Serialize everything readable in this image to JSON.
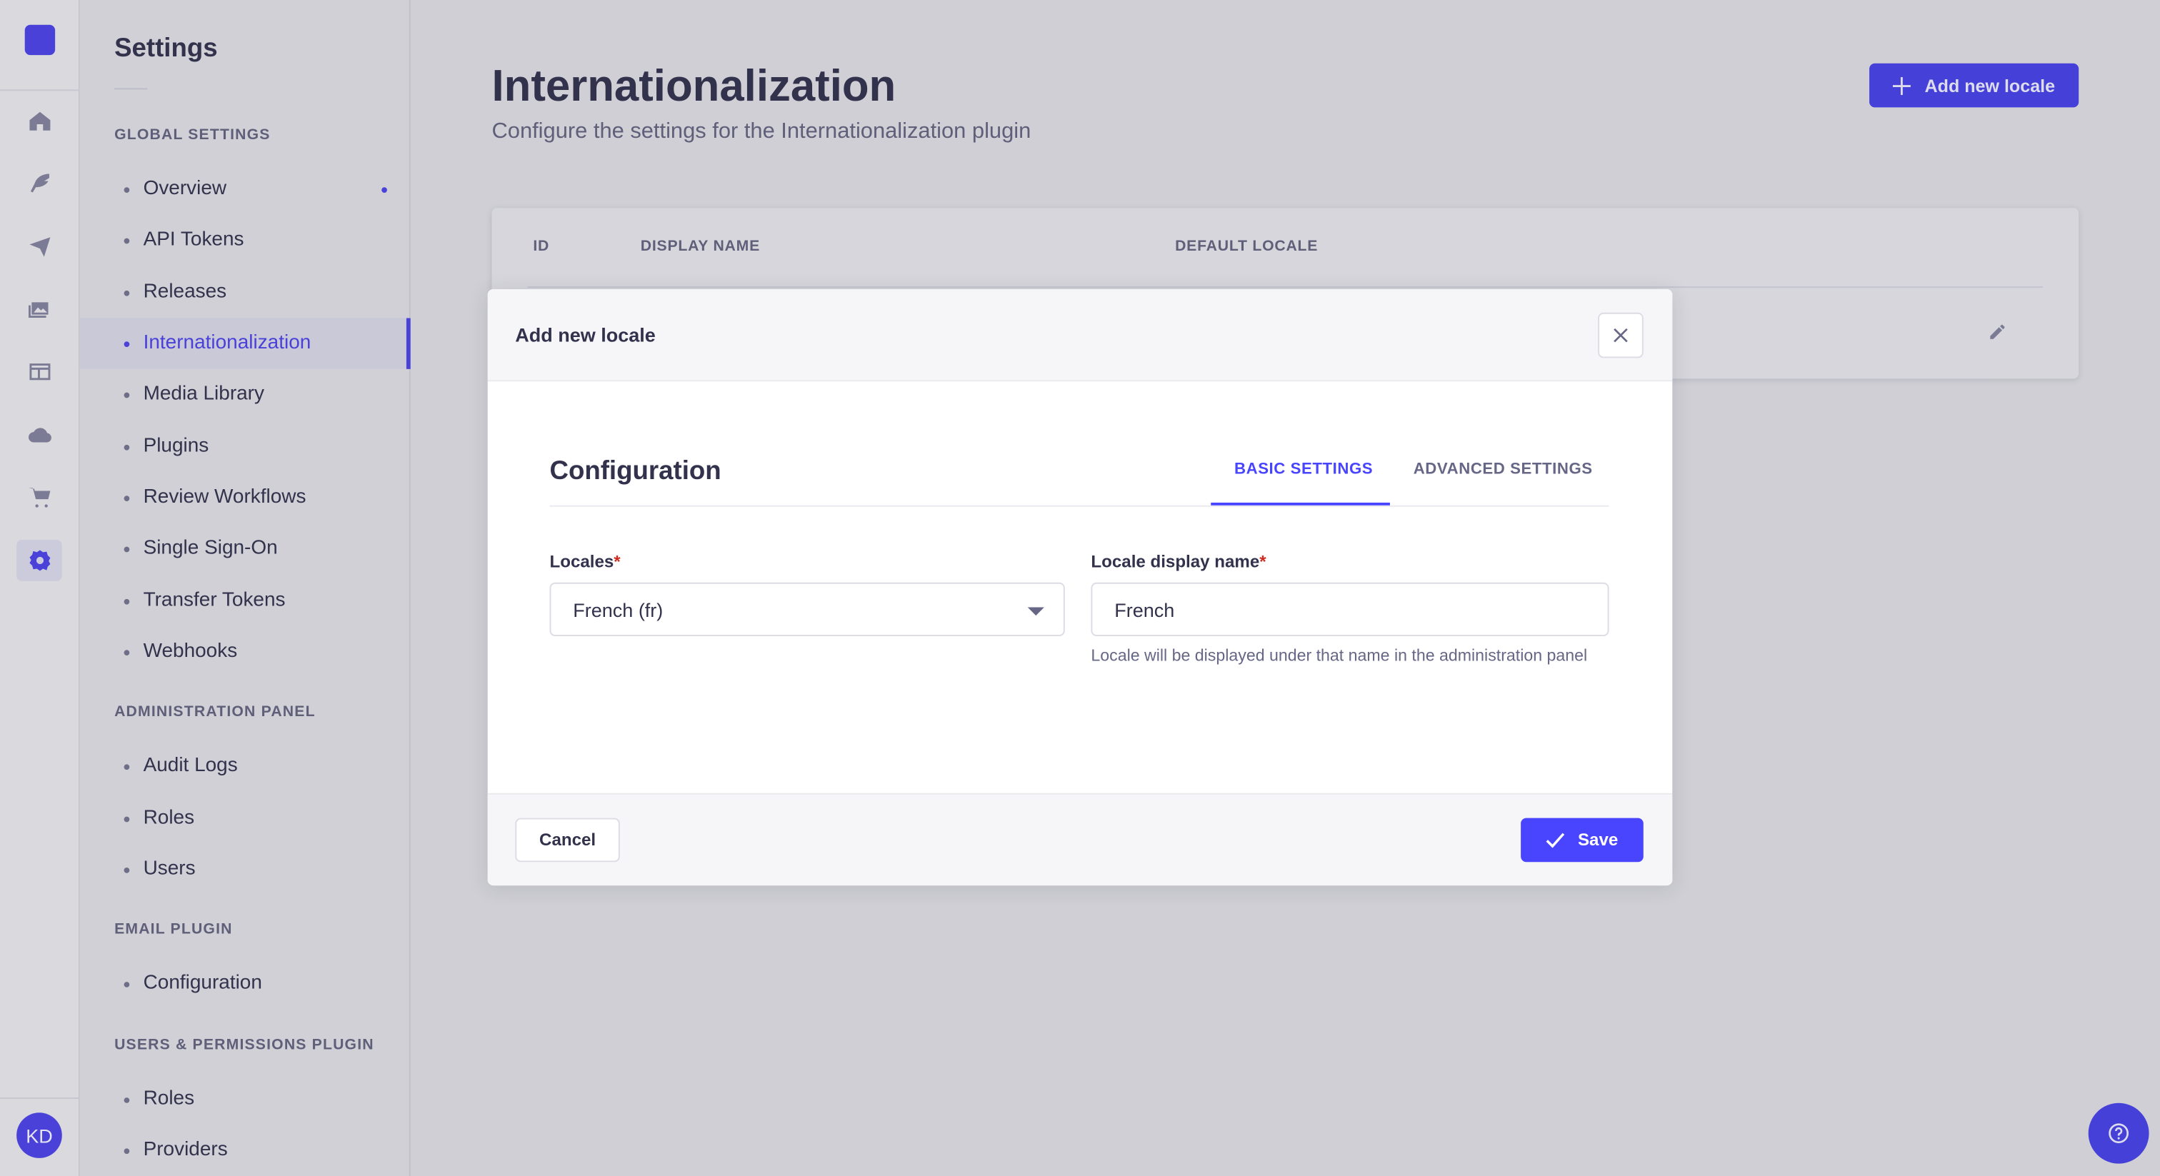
{
  "rail": {
    "icons": [
      "home-icon",
      "content-manager-icon",
      "releases-icon",
      "media-library-icon",
      "content-type-builder-icon",
      "cloud-icon",
      "marketplace-icon",
      "settings-icon"
    ],
    "active": "settings-icon",
    "avatar_initials": "KD"
  },
  "sidebar": {
    "title": "Settings",
    "sections": [
      {
        "header": "GLOBAL SETTINGS",
        "items": [
          {
            "label": "Overview",
            "badge": true
          },
          {
            "label": "API Tokens"
          },
          {
            "label": "Releases"
          },
          {
            "label": "Internationalization",
            "active": true
          },
          {
            "label": "Media Library"
          },
          {
            "label": "Plugins"
          },
          {
            "label": "Review Workflows"
          },
          {
            "label": "Single Sign-On"
          },
          {
            "label": "Transfer Tokens"
          },
          {
            "label": "Webhooks"
          }
        ]
      },
      {
        "header": "ADMINISTRATION PANEL",
        "items": [
          {
            "label": "Audit Logs"
          },
          {
            "label": "Roles"
          },
          {
            "label": "Users"
          }
        ]
      },
      {
        "header": "EMAIL PLUGIN",
        "items": [
          {
            "label": "Configuration"
          }
        ]
      },
      {
        "header": "USERS & PERMISSIONS PLUGIN",
        "items": [
          {
            "label": "Roles"
          },
          {
            "label": "Providers"
          }
        ]
      }
    ]
  },
  "header": {
    "title": "Internationalization",
    "subtitle": "Configure the settings for the Internationalization plugin",
    "add_button": "Add new locale"
  },
  "table": {
    "columns": [
      "ID",
      "DISPLAY NAME",
      "DEFAULT LOCALE"
    ]
  },
  "modal": {
    "title": "Add new locale",
    "section_title": "Configuration",
    "tabs": [
      {
        "label": "BASIC SETTINGS",
        "active": true
      },
      {
        "label": "ADVANCED SETTINGS",
        "active": false
      }
    ],
    "locales_label": "Locales",
    "locales_value": "French (fr)",
    "display_name_label": "Locale display name",
    "display_name_value": "French",
    "display_name_hint": "Locale will be displayed under that name in the administration panel",
    "required_mark": "*",
    "cancel": "Cancel",
    "save": "Save"
  },
  "colors": {
    "primary": "#4945ff",
    "required": "#d02b20"
  }
}
